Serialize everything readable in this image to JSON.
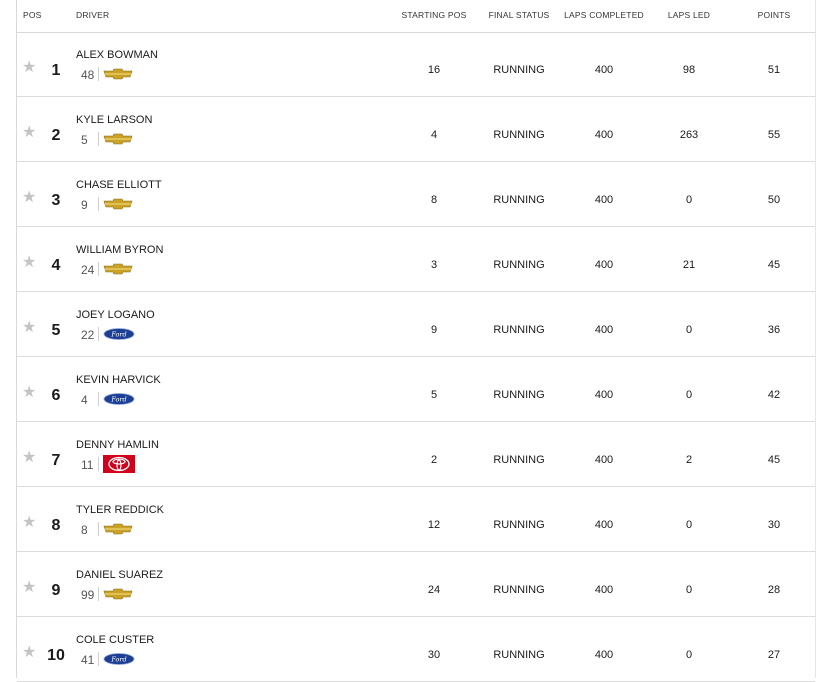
{
  "columns": {
    "pos": "POS",
    "driver": "DRIVER",
    "starting_pos": "STARTING POS",
    "final_status": "FINAL STATUS",
    "laps_completed": "LAPS COMPLETED",
    "laps_led": "LAPS LED",
    "points": "POINTS"
  },
  "icons": {
    "favorite": "star-icon",
    "chevrolet": "chevrolet-logo-icon",
    "ford": "ford-logo-icon",
    "toyota": "toyota-logo-icon"
  },
  "colors": {
    "star": "#c4c4c4",
    "chevrolet": "#c9a227",
    "ford": "#1c3f94",
    "toyota": "#d0021b"
  },
  "rows": [
    {
      "pos": "1",
      "driver": "ALEX BOWMAN",
      "car": "48",
      "make": "chevrolet",
      "start": "16",
      "status": "RUNNING",
      "laps": "400",
      "led": "98",
      "points": "51"
    },
    {
      "pos": "2",
      "driver": "KYLE LARSON",
      "car": "5",
      "make": "chevrolet",
      "start": "4",
      "status": "RUNNING",
      "laps": "400",
      "led": "263",
      "points": "55"
    },
    {
      "pos": "3",
      "driver": "CHASE ELLIOTT",
      "car": "9",
      "make": "chevrolet",
      "start": "8",
      "status": "RUNNING",
      "laps": "400",
      "led": "0",
      "points": "50"
    },
    {
      "pos": "4",
      "driver": "WILLIAM BYRON",
      "car": "24",
      "make": "chevrolet",
      "start": "3",
      "status": "RUNNING",
      "laps": "400",
      "led": "21",
      "points": "45"
    },
    {
      "pos": "5",
      "driver": "JOEY LOGANO",
      "car": "22",
      "make": "ford",
      "start": "9",
      "status": "RUNNING",
      "laps": "400",
      "led": "0",
      "points": "36"
    },
    {
      "pos": "6",
      "driver": "KEVIN HARVICK",
      "car": "4",
      "make": "ford",
      "start": "5",
      "status": "RUNNING",
      "laps": "400",
      "led": "0",
      "points": "42"
    },
    {
      "pos": "7",
      "driver": "DENNY HAMLIN",
      "car": "11",
      "make": "toyota",
      "start": "2",
      "status": "RUNNING",
      "laps": "400",
      "led": "2",
      "points": "45"
    },
    {
      "pos": "8",
      "driver": "TYLER REDDICK",
      "car": "8",
      "make": "chevrolet",
      "start": "12",
      "status": "RUNNING",
      "laps": "400",
      "led": "0",
      "points": "30"
    },
    {
      "pos": "9",
      "driver": "DANIEL SUAREZ",
      "car": "99",
      "make": "chevrolet",
      "start": "24",
      "status": "RUNNING",
      "laps": "400",
      "led": "0",
      "points": "28"
    },
    {
      "pos": "10",
      "driver": "COLE CUSTER",
      "car": "41",
      "make": "ford",
      "start": "30",
      "status": "RUNNING",
      "laps": "400",
      "led": "0",
      "points": "27"
    }
  ]
}
